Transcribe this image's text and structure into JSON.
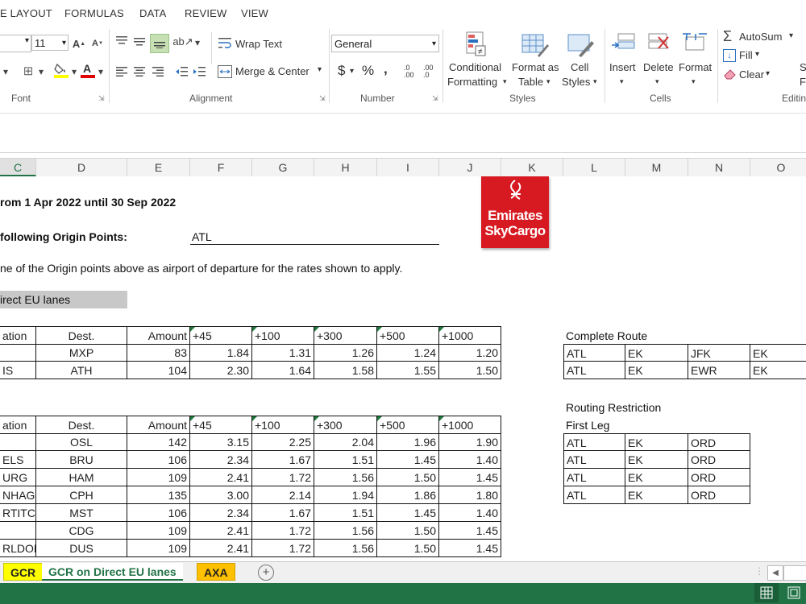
{
  "menu_tabs": [
    "E LAYOUT",
    "FORMULAS",
    "DATA",
    "REVIEW",
    "VIEW"
  ],
  "ribbon": {
    "font_size": "11",
    "groups": {
      "font": "Font",
      "alignment": "Alignment",
      "number": "Number",
      "styles": "Styles",
      "cells": "Cells",
      "editing": "Editin"
    },
    "wrap_text": "Wrap Text",
    "merge_center": "Merge & Center",
    "number_format": "General",
    "conditional_formatting": [
      "Conditional",
      "Formatting"
    ],
    "format_as_table": [
      "Format as",
      "Table"
    ],
    "cell_styles": [
      "Cell",
      "Styles"
    ],
    "insert": "Insert",
    "delete": "Delete",
    "format": "Format",
    "autosum": "AutoSum",
    "fill": "Fill",
    "clear": "Clear",
    "currency_symbol": "$",
    "percent_symbol": "%",
    "comma_symbol": ",",
    "increase_decimal": ".0 .00",
    "decrease_decimal": ".00 .0",
    "extra_partial": "S\nF"
  },
  "columns": [
    "C",
    "D",
    "E",
    "F",
    "G",
    "H",
    "I",
    "J",
    "K",
    "L",
    "M",
    "N",
    "O"
  ],
  "sheet": {
    "validity": "rom 1 Apr 2022 until 30 Sep 2022",
    "origin_label": "following Origin Points:",
    "origin_value": "ATL",
    "note": "ne of the Origin points above as airport of departure for the rates shown to apply.",
    "section": "irect EU lanes",
    "logo_line1": "Emirates",
    "logo_line2": "SkyCargo",
    "table1": {
      "headers": [
        "ation",
        "Dest.",
        "Amount",
        "+45",
        "+100",
        "+300",
        "+500",
        "+1000"
      ],
      "rows": [
        [
          "",
          "MXP",
          "83",
          "1.84",
          "1.31",
          "1.26",
          "1.24",
          "1.20"
        ],
        [
          "IS",
          "ATH",
          "104",
          "2.30",
          "1.64",
          "1.58",
          "1.55",
          "1.50"
        ]
      ]
    },
    "table2": {
      "headers": [
        "ation",
        "Dest.",
        "Amount",
        "+45",
        "+100",
        "+300",
        "+500",
        "+1000"
      ],
      "rows": [
        [
          "",
          "OSL",
          "142",
          "3.15",
          "2.25",
          "2.04",
          "1.96",
          "1.90"
        ],
        [
          "ELS",
          "BRU",
          "106",
          "2.34",
          "1.67",
          "1.51",
          "1.45",
          "1.40"
        ],
        [
          "URG",
          "HAM",
          "109",
          "2.41",
          "1.72",
          "1.56",
          "1.50",
          "1.45"
        ],
        [
          "NHAGEI",
          "CPH",
          "135",
          "3.00",
          "2.14",
          "1.94",
          "1.86",
          "1.80"
        ],
        [
          "RTITCH",
          "MST",
          "106",
          "2.34",
          "1.67",
          "1.51",
          "1.45",
          "1.40"
        ],
        [
          "",
          "CDG",
          "109",
          "2.41",
          "1.72",
          "1.56",
          "1.50",
          "1.45"
        ],
        [
          "RLDOR",
          "DUS",
          "109",
          "2.41",
          "1.72",
          "1.56",
          "1.50",
          "1.45"
        ]
      ]
    },
    "complete_route_title": "Complete Route",
    "complete_route_rows": [
      [
        "ATL",
        "EK",
        "JFK",
        "EK"
      ],
      [
        "ATL",
        "EK",
        "EWR",
        "EK"
      ]
    ],
    "routing_title": "Routing Restriction",
    "first_leg_title": "First Leg",
    "first_leg_rows": [
      [
        "ATL",
        "EK",
        "ORD"
      ],
      [
        "ATL",
        "EK",
        "ORD"
      ],
      [
        "ATL",
        "EK",
        "ORD"
      ],
      [
        "ATL",
        "EK",
        "ORD"
      ]
    ]
  },
  "sheet_tabs": [
    "GCR",
    "GCR on Direct EU lanes",
    "AXA"
  ],
  "colors": {
    "excel_green": "#217346",
    "tab_yellow": "#ffff00",
    "tab_orange": "#ffc000",
    "logo_red": "#d71921"
  }
}
